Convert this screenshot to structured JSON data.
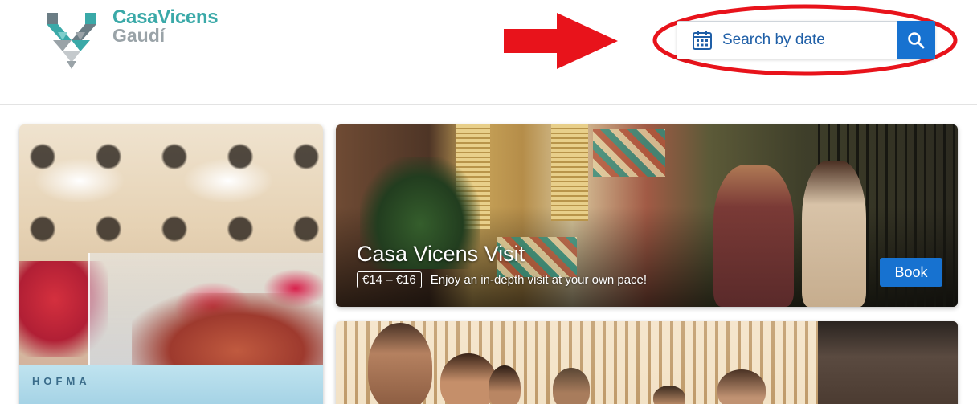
{
  "brand": {
    "line1": "CasaVicens",
    "line2": "Gaudí"
  },
  "search": {
    "label": "Search by date"
  },
  "cards": {
    "left": {
      "tray_text": "HOFMA"
    },
    "visit": {
      "title": "Casa Vicens Visit",
      "price": "€14 – €16",
      "description": "Enjoy an in-depth visit at your own pace!",
      "book_label": "Book"
    }
  },
  "colors": {
    "accent_blue": "#1772d0",
    "brand_teal": "#3aa9a8",
    "brand_grey": "#9aa3a8",
    "annotation_red": "#e8131b"
  },
  "icons": {
    "calendar": "calendar-icon",
    "search": "search-icon",
    "arrow": "red-arrow-annotation",
    "ellipse": "red-ellipse-annotation"
  }
}
